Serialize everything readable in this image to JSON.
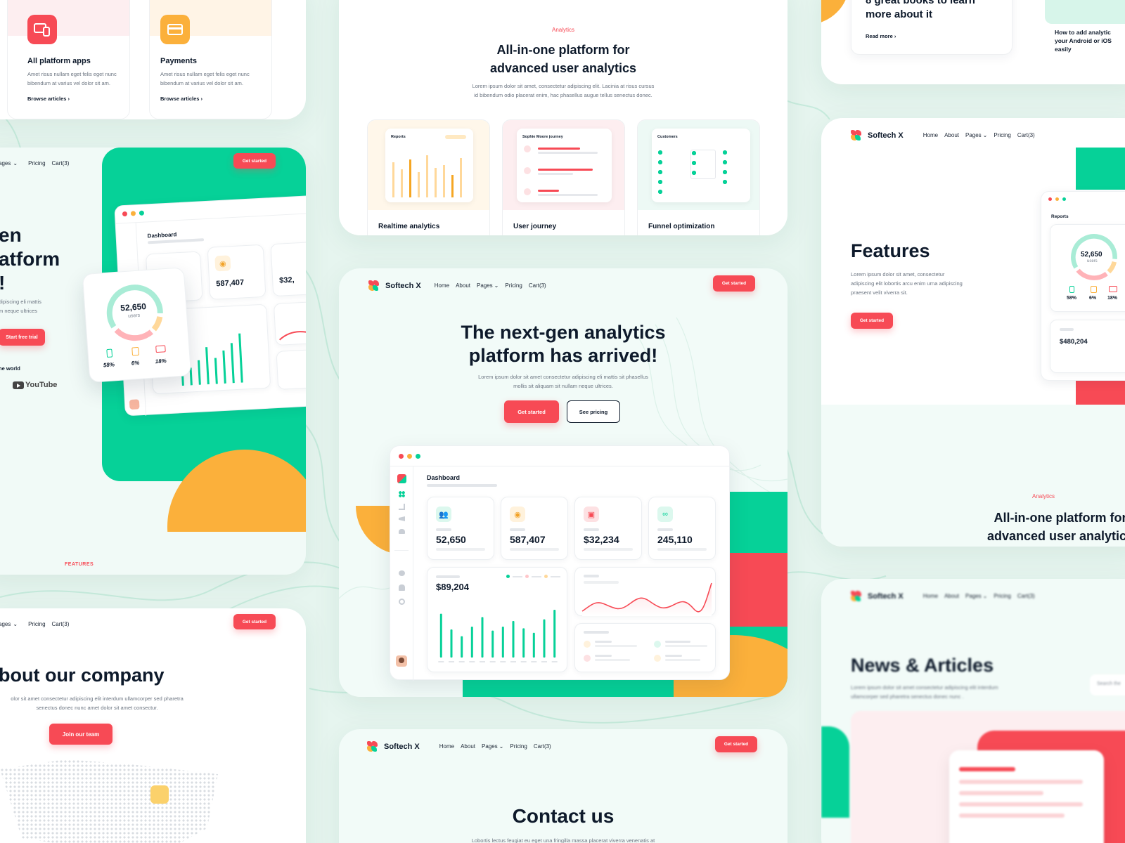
{
  "brand": {
    "name": "Softech X",
    "accent_red": "#f74a55",
    "accent_green": "#06d198",
    "accent_orange": "#fbb03b"
  },
  "nav": {
    "home": "Home",
    "about": "About",
    "pages": "Pages",
    "pricing": "Pricing",
    "cart": "Cart(3)",
    "cta": "Get started"
  },
  "partial_nav": {
    "pages": "ages",
    "pricing": "Pricing",
    "cart": "Cart(3)",
    "cta": "Get started"
  },
  "help_cards": {
    "items": [
      {
        "title": "All platform apps",
        "text": "Amet risus nullam eget felis eget nunc bibendum at varius vel dolor sit am.",
        "link": "Browse articles"
      },
      {
        "title": "Payments",
        "text": "Amet risus nullam eget felis eget nunc bibendum at varius vel dolor sit am.",
        "link": "Browse articles"
      }
    ]
  },
  "analytics_section": {
    "eyebrow": "Analytics",
    "title_line1": "All-in-one platform for",
    "title_line2": "advanced user analytics",
    "desc_line1": "Lorem ipsum dolor sit amet, consectetur adipiscing elit. Lacinia at risus cursus",
    "desc_line2": "id bibendum odio placerat enim, hac phasellus augue tellus senectus donec.",
    "features": [
      {
        "title": "Realtime analytics",
        "preview": "Reports"
      },
      {
        "title": "User journey",
        "preview": "Sophie Moore journey"
      },
      {
        "title": "Funnel optimization",
        "preview": "Customers"
      }
    ]
  },
  "left_hero": {
    "title_l1": "en",
    "title_l2": "atform",
    "title_l3": "!",
    "text_l1": "dipiscing eli mattis",
    "text_l2": "m neque ultrices",
    "cta": "Start free trial",
    "world": "he world",
    "youtube": "YouTube",
    "features_label": "FEATURES",
    "users_count": "52,650",
    "users_label": "users",
    "pcts": [
      "58%",
      "6%",
      "18%"
    ],
    "dash_title": "Dashboard",
    "dash_val": "587,407",
    "dash_val2": "$32,"
  },
  "main_hero": {
    "title_line1": "The next-gen analytics",
    "title_line2": "platform has arrived!",
    "desc_line1": "Lorem ipsum dolor sit amet consectetur adipiscing eli mattis sit phasellus",
    "desc_line2": "mollis sit aliquam sit nullam neque ultrices.",
    "primary_cta": "Get started",
    "secondary_cta": "See pricing"
  },
  "dashboard": {
    "title": "Dashboard",
    "stats": [
      {
        "value": "52,650",
        "icon": "users-icon"
      },
      {
        "value": "587,407",
        "icon": "eye-icon"
      },
      {
        "value": "$32,234",
        "icon": "wallet-icon"
      },
      {
        "value": "245,110",
        "icon": "link-icon"
      }
    ],
    "revenue": "$89,204"
  },
  "chart_data": {
    "type": "bar",
    "categories": [
      "1",
      "2",
      "3",
      "4",
      "5",
      "6",
      "7",
      "8",
      "9",
      "10",
      "11",
      "12"
    ],
    "values": [
      78,
      50,
      38,
      55,
      72,
      48,
      55,
      65,
      52,
      44,
      68,
      85
    ],
    "ylim": [
      0,
      100
    ]
  },
  "left_about": {
    "title": "bout our company",
    "text_l1": "olor sit amet consectetur adipiscing elit interdum ullamcorper sed pharetra",
    "text_l2": "senectus donec nunc amet dolor sit amet consectur.",
    "cta": "Join our team"
  },
  "contact": {
    "title": "Contact us",
    "desc": "Lobortis lectus feugiat eu eget una fringilla massa placerat viverra venenatis at"
  },
  "blog_top": {
    "title_l1": "8 great books to learn",
    "title_l2": "more about it",
    "link": "Read more",
    "side_l1": "How to add analytic",
    "side_l2": "your Android or iOS",
    "side_l3": "easily"
  },
  "right_features": {
    "title": "Features",
    "text_l1": "Lorem ipsum dolor sit amet, consectetur",
    "text_l2": "adipiscing elit lobortis arcu enim urna adipiscing",
    "text_l3": "praesent velit viverra sit.",
    "cta": "Get started",
    "reports": "Reports",
    "users_count": "52,650",
    "users_label": "users",
    "pcts": [
      "58%",
      "6%",
      "18%"
    ],
    "revenue": "$480,204",
    "eyebrow": "Analytics",
    "title_l1": "All-in-one platform for",
    "title_l2": "advanced user analytics"
  },
  "right_news": {
    "title": "News & Articles",
    "text_l1": "Lorem ipsum dolor sit amet consectetur adipiscing elit interdum",
    "text_l2": "ullamcorper sed pharetra senectus donec nunc .",
    "search": "Search the"
  }
}
